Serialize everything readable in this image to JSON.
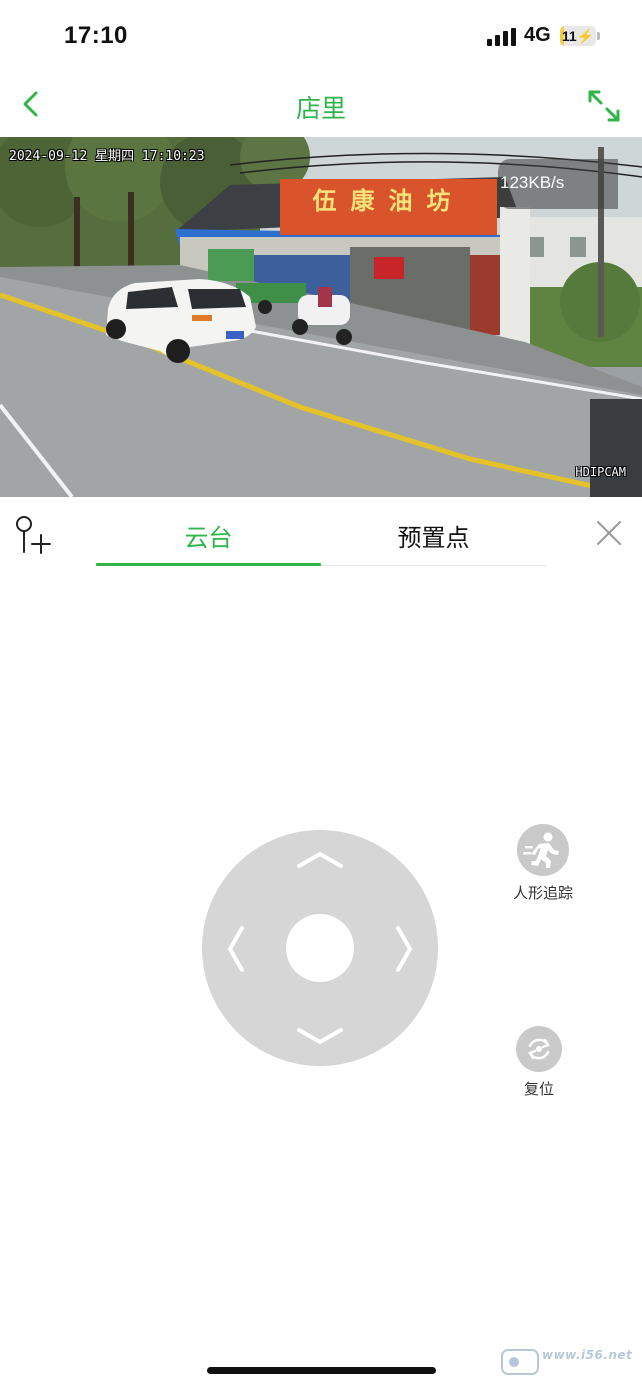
{
  "status_bar": {
    "time": "17:10",
    "network": "4G",
    "battery_level_percent": 11,
    "battery_label": "11"
  },
  "header": {
    "title": "店里",
    "back_icon": "chevron-left-icon",
    "fullscreen_icon": "expand-icon"
  },
  "video": {
    "osd_timestamp": "2024-09-12 星期四 17:10:23",
    "bitrate": "123KB/s",
    "brand_watermark": "HDIPCAM",
    "shop_sign": "伍康油坊"
  },
  "tabs": [
    {
      "label": "云台",
      "active": true
    },
    {
      "label": "预置点",
      "active": false
    }
  ],
  "controls": {
    "human_tracking_label": "人形追踪",
    "reset_label": "复位"
  },
  "watermark": {
    "text": "www.i56.net"
  },
  "colors": {
    "accent": "#2fb54a",
    "joystick": "#d6d6d6",
    "side_button": "#c9c9c9"
  }
}
